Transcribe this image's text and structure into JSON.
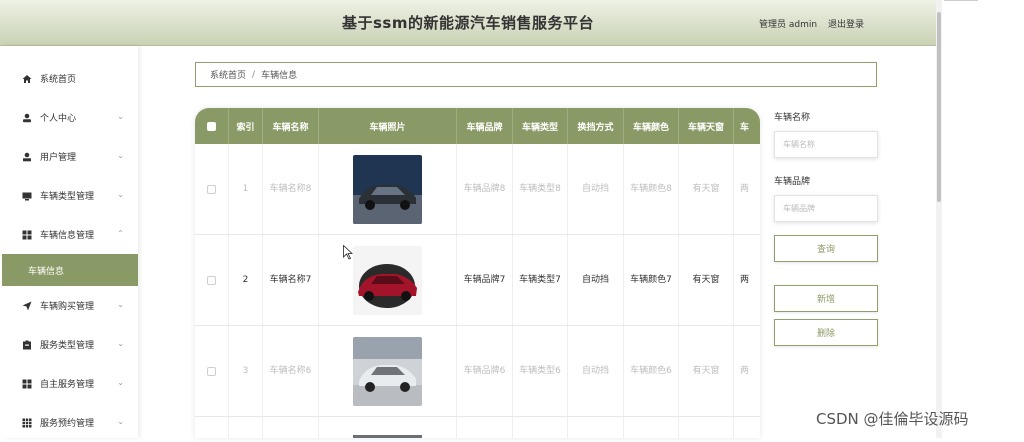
{
  "header": {
    "title": "基于ssm的新能源汽车销售服务平台",
    "user_label": "管理员 admin",
    "logout": "退出登录"
  },
  "sidebar": {
    "items": [
      {
        "label": "系统首页",
        "icon": "home-icon",
        "chevron": false
      },
      {
        "label": "个人中心",
        "icon": "person-icon",
        "chevron": true
      },
      {
        "label": "用户管理",
        "icon": "user-icon",
        "chevron": true
      },
      {
        "label": "车辆类型管理",
        "icon": "monitor-icon",
        "chevron": true
      },
      {
        "label": "车辆信息管理",
        "icon": "grid-icon",
        "chevron": true,
        "expanded": true
      },
      {
        "label": "车辆购买管理",
        "icon": "send-icon",
        "chevron": true
      },
      {
        "label": "服务类型管理",
        "icon": "clipboard-icon",
        "chevron": true
      },
      {
        "label": "自主服务管理",
        "icon": "grid-icon",
        "chevron": true
      },
      {
        "label": "服务预约管理",
        "icon": "table-icon",
        "chevron": true
      }
    ],
    "sub_item": "车辆信息"
  },
  "breadcrumb": {
    "home": "系统首页",
    "separator": "/",
    "current": "车辆信息"
  },
  "table": {
    "columns": [
      "",
      "索引",
      "车辆名称",
      "车辆照片",
      "车辆品牌",
      "车辆类型",
      "换挡方式",
      "车辆颜色",
      "车辆天窗",
      "车"
    ],
    "rows": [
      {
        "index": "1",
        "name": "车辆名称8",
        "brand": "车辆品牌8",
        "type": "车辆类型8",
        "gear": "自动挡",
        "color": "车辆颜色8",
        "sunroof": "有天窗",
        "extra": "两",
        "car_color": "#2b2f36"
      },
      {
        "index": "2",
        "name": "车辆名称7",
        "brand": "车辆品牌7",
        "type": "车辆类型7",
        "gear": "自动挡",
        "color": "车辆颜色7",
        "sunroof": "有天窗",
        "extra": "两",
        "car_color": "#a3142a"
      },
      {
        "index": "3",
        "name": "车辆名称6",
        "brand": "车辆品牌6",
        "type": "车辆类型6",
        "gear": "自动挡",
        "color": "车辆颜色6",
        "sunroof": "有天窗",
        "extra": "两",
        "car_color": "#e9ecef"
      }
    ]
  },
  "search": {
    "name_label": "车辆名称",
    "name_placeholder": "车辆名称",
    "brand_label": "车辆品牌",
    "brand_placeholder": "车辆品牌",
    "query_button": "查询",
    "add_button": "新增",
    "delete_button": "删除"
  },
  "watermark": "CSDN @佳倫毕设源码",
  "colors": {
    "accent": "#8a9a66",
    "header_gradient_top": "#eef1e6",
    "header_gradient_bottom": "#c9d2b4"
  }
}
